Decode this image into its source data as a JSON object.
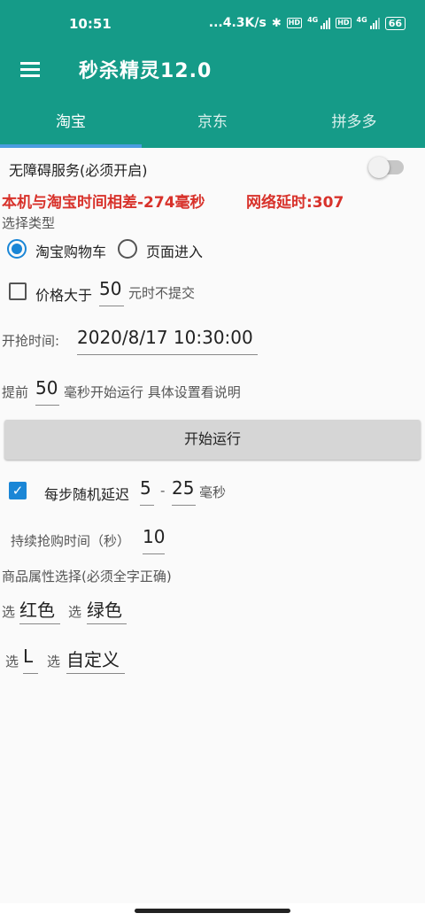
{
  "status_bar": {
    "time": "10:51",
    "net_speed": "...4.3K/s",
    "battery": "66"
  },
  "app_bar": {
    "title": "秒杀精灵12.0"
  },
  "tabs": [
    {
      "label": "淘宝",
      "active": true
    },
    {
      "label": "京东",
      "active": false
    },
    {
      "label": "拼多多",
      "active": false
    }
  ],
  "accessibility": {
    "label": "无障碍服务(必须开启)",
    "enabled": false
  },
  "time_diff_text": "本机与淘宝时间相差-274毫秒",
  "latency_text": "网络延时:307",
  "select_type": {
    "label": "选择类型",
    "options": [
      "淘宝购物车",
      "页面进入"
    ],
    "selected": "淘宝购物车"
  },
  "price_limit": {
    "checked": false,
    "prefix": "价格大于",
    "value": "50",
    "suffix": "元时不提交"
  },
  "start_time": {
    "label": "开抢时间:",
    "value": "2020/8/17 10:30:00"
  },
  "advance": {
    "prefix": "提前",
    "value": "50",
    "suffix": "毫秒开始运行 具体设置看说明"
  },
  "run_button_label": "开始运行",
  "random_delay": {
    "checked": true,
    "label": "每步随机延迟",
    "min": "5",
    "separator": "-",
    "max": "25",
    "unit": "毫秒"
  },
  "duration": {
    "label": "持续抢购时间（秒）",
    "value": "10"
  },
  "attributes": {
    "label": "商品属性选择(必须全字正确)",
    "select_word": "选",
    "values": [
      "红色",
      "绿色",
      "L",
      "自定义"
    ]
  }
}
